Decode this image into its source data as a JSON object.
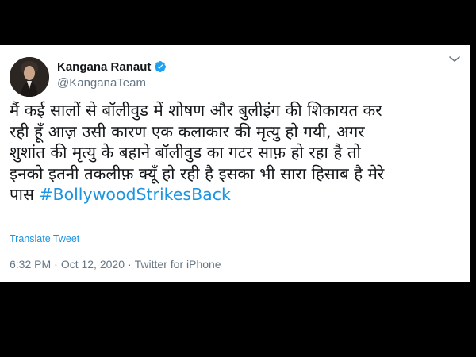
{
  "tweet": {
    "author": {
      "display_name": "Kangana Ranaut",
      "handle": "@KanganaTeam",
      "verified": true
    },
    "text_lines": [
      "मैं कई सालों से बॉलीवुड में शोषण और बुलीइंग की शिकायत कर",
      "रही हूँ आज़ उसी कारण एक कलाकार की मृत्यु हो गयी, अगर",
      "शुशांत की मृत्यु के बहाने बॉलीवुड का गटर साफ़ हो रहा है तो",
      "इनको इतनी तकलीफ़ क्यूँ हो रही है इसका भी सारा हिसाब है मेरे"
    ],
    "last_line_prefix": "पास ",
    "hashtag": "#BollywoodStrikesBack",
    "translate_label": "Translate Tweet",
    "time": "6:32 PM",
    "separator": "·",
    "date": "Oct 12, 2020",
    "source": "Twitter for iPhone"
  },
  "colors": {
    "link": "#1b95e0",
    "text": "#14171a",
    "muted": "#657786",
    "verified": "#1da1f2"
  },
  "icons": {
    "verified": "verified-badge-icon",
    "more": "more-options-icon"
  }
}
